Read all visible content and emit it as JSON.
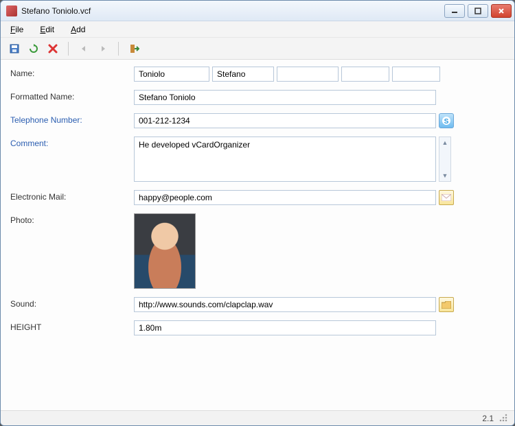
{
  "window": {
    "title": "Stefano Toniolo.vcf"
  },
  "menubar": {
    "file": "File",
    "edit": "Edit",
    "add": "Add"
  },
  "labels": {
    "name": "Name:",
    "formatted_name": "Formatted Name:",
    "telephone": "Telephone Number:",
    "comment": "Comment:",
    "email": "Electronic Mail:",
    "photo": "Photo:",
    "sound": "Sound:",
    "height": "HEIGHT"
  },
  "fields": {
    "family_name": "Toniolo",
    "given_name": "Stefano",
    "additional_name": "",
    "prefix": "",
    "suffix": "",
    "formatted_name": "Stefano Toniolo",
    "telephone": "001-212-1234",
    "comment": "He developed vCardOrganizer",
    "email": "happy@people.com",
    "sound": "http://www.sounds.com/clapclap.wav",
    "height": "1.80m"
  },
  "statusbar": {
    "version": "2.1"
  }
}
